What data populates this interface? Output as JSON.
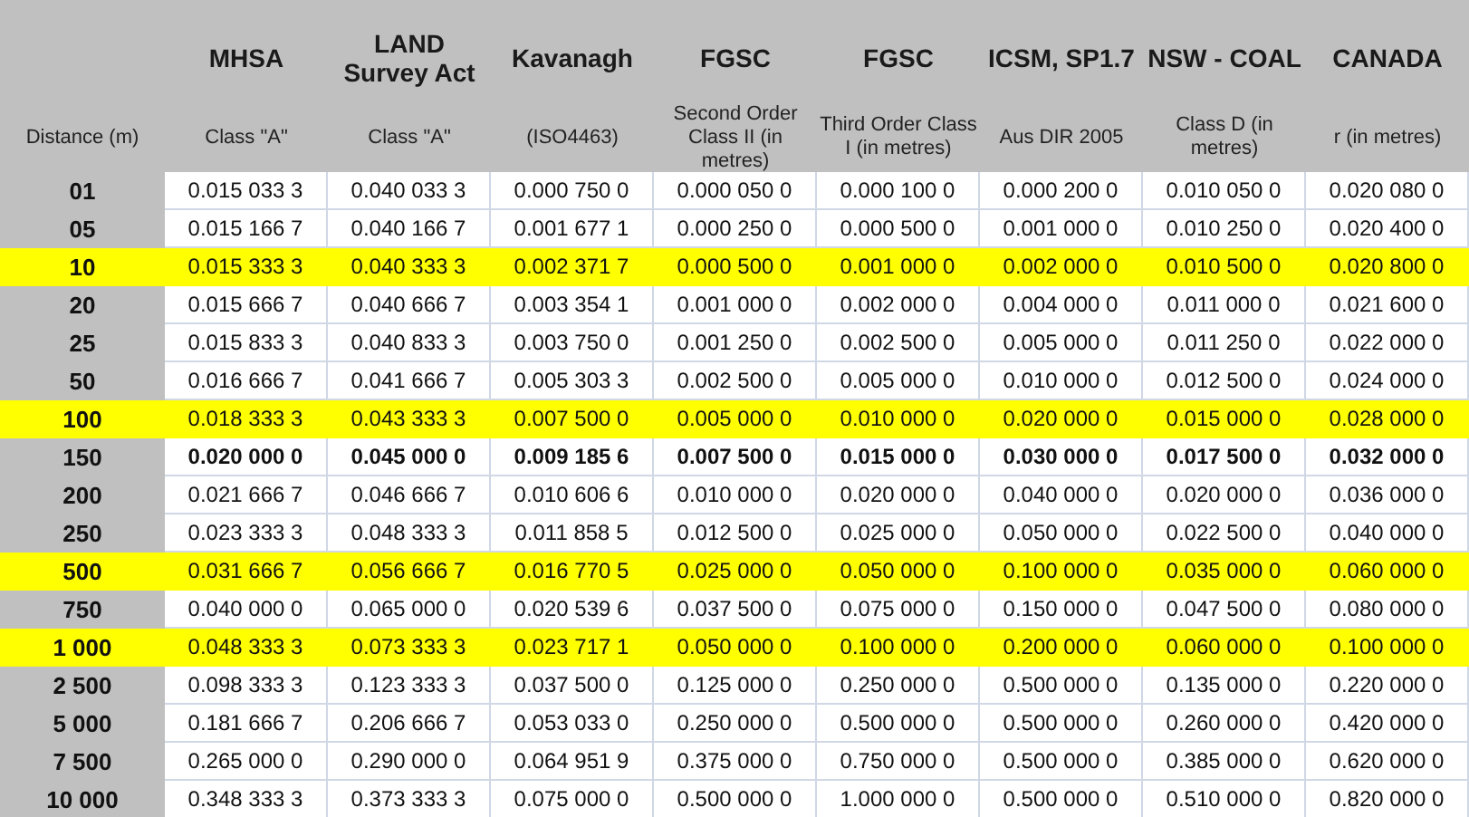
{
  "table": {
    "distance_header": "Distance (m)",
    "columns": [
      {
        "title": "MHSA",
        "subtitle": "Class \"A\""
      },
      {
        "title": "LAND Survey Act",
        "subtitle": "Class \"A\""
      },
      {
        "title": "Kavanagh",
        "subtitle": "(ISO4463)"
      },
      {
        "title": "FGSC",
        "subtitle": "Second Order Class II (in metres)"
      },
      {
        "title": "FGSC",
        "subtitle": "Third Order Class I (in metres)"
      },
      {
        "title": "ICSM, SP1.7",
        "subtitle": "Aus DIR 2005"
      },
      {
        "title": "NSW - COAL",
        "subtitle": "Class D (in metres)"
      },
      {
        "title": "CANADA",
        "subtitle": "r (in metres)"
      }
    ],
    "rows": [
      {
        "distance": "01",
        "highlighted": false,
        "bold": false,
        "values": [
          "0.015 033 3",
          "0.040 033 3",
          "0.000 750 0",
          "0.000 050 0",
          "0.000 100 0",
          "0.000 200 0",
          "0.010 050 0",
          "0.020 080 0"
        ]
      },
      {
        "distance": "05",
        "highlighted": false,
        "bold": false,
        "values": [
          "0.015 166 7",
          "0.040 166 7",
          "0.001 677 1",
          "0.000 250 0",
          "0.000 500 0",
          "0.001 000 0",
          "0.010 250 0",
          "0.020 400 0"
        ]
      },
      {
        "distance": "10",
        "highlighted": true,
        "bold": false,
        "values": [
          "0.015 333 3",
          "0.040 333 3",
          "0.002 371 7",
          "0.000 500 0",
          "0.001 000 0",
          "0.002 000 0",
          "0.010 500 0",
          "0.020 800 0"
        ]
      },
      {
        "distance": "20",
        "highlighted": false,
        "bold": false,
        "values": [
          "0.015 666 7",
          "0.040 666 7",
          "0.003 354 1",
          "0.001 000 0",
          "0.002 000 0",
          "0.004 000 0",
          "0.011 000 0",
          "0.021 600 0"
        ]
      },
      {
        "distance": "25",
        "highlighted": false,
        "bold": false,
        "values": [
          "0.015 833 3",
          "0.040 833 3",
          "0.003 750 0",
          "0.001 250 0",
          "0.002 500 0",
          "0.005 000 0",
          "0.011 250 0",
          "0.022 000 0"
        ]
      },
      {
        "distance": "50",
        "highlighted": false,
        "bold": false,
        "values": [
          "0.016 666 7",
          "0.041 666 7",
          "0.005 303 3",
          "0.002 500 0",
          "0.005 000 0",
          "0.010 000 0",
          "0.012 500 0",
          "0.024 000 0"
        ]
      },
      {
        "distance": "100",
        "highlighted": true,
        "bold": false,
        "values": [
          "0.018 333 3",
          "0.043 333 3",
          "0.007 500 0",
          "0.005 000 0",
          "0.010 000 0",
          "0.020 000 0",
          "0.015 000 0",
          "0.028 000 0"
        ]
      },
      {
        "distance": "150",
        "highlighted": false,
        "bold": true,
        "values": [
          "0.020 000 0",
          "0.045 000 0",
          "0.009 185 6",
          "0.007 500 0",
          "0.015 000 0",
          "0.030 000 0",
          "0.017 500 0",
          "0.032 000 0"
        ]
      },
      {
        "distance": "200",
        "highlighted": false,
        "bold": false,
        "values": [
          "0.021 666 7",
          "0.046 666 7",
          "0.010 606 6",
          "0.010 000 0",
          "0.020 000 0",
          "0.040 000 0",
          "0.020 000 0",
          "0.036 000 0"
        ]
      },
      {
        "distance": "250",
        "highlighted": false,
        "bold": false,
        "values": [
          "0.023 333 3",
          "0.048 333 3",
          "0.011 858 5",
          "0.012 500 0",
          "0.025 000 0",
          "0.050 000 0",
          "0.022 500 0",
          "0.040 000 0"
        ]
      },
      {
        "distance": "500",
        "highlighted": true,
        "bold": false,
        "values": [
          "0.031 666 7",
          "0.056 666 7",
          "0.016 770 5",
          "0.025 000 0",
          "0.050 000 0",
          "0.100 000 0",
          "0.035 000 0",
          "0.060 000 0"
        ]
      },
      {
        "distance": "750",
        "highlighted": false,
        "bold": false,
        "values": [
          "0.040 000 0",
          "0.065 000 0",
          "0.020 539 6",
          "0.037 500 0",
          "0.075 000 0",
          "0.150 000 0",
          "0.047 500 0",
          "0.080 000 0"
        ]
      },
      {
        "distance": "1 000",
        "highlighted": true,
        "bold": false,
        "values": [
          "0.048 333 3",
          "0.073 333 3",
          "0.023 717 1",
          "0.050 000 0",
          "0.100 000 0",
          "0.200 000 0",
          "0.060 000 0",
          "0.100 000 0"
        ]
      },
      {
        "distance": "2 500",
        "highlighted": false,
        "bold": false,
        "values": [
          "0.098 333 3",
          "0.123 333 3",
          "0.037 500 0",
          "0.125 000 0",
          "0.250 000 0",
          "0.500 000 0",
          "0.135 000 0",
          "0.220 000 0"
        ]
      },
      {
        "distance": "5 000",
        "highlighted": false,
        "bold": false,
        "values": [
          "0.181 666 7",
          "0.206 666 7",
          "0.053 033 0",
          "0.250 000 0",
          "0.500 000 0",
          "0.500 000 0",
          "0.260 000 0",
          "0.420 000 0"
        ]
      },
      {
        "distance": "7 500",
        "highlighted": false,
        "bold": false,
        "values": [
          "0.265 000 0",
          "0.290 000 0",
          "0.064 951 9",
          "0.375 000 0",
          "0.750 000 0",
          "0.500 000 0",
          "0.385 000 0",
          "0.620 000 0"
        ]
      },
      {
        "distance": "10 000",
        "highlighted": false,
        "bold": false,
        "values": [
          "0.348 333 3",
          "0.373 333 3",
          "0.075 000 0",
          "0.500 000 0",
          "1.000 000 0",
          "0.500 000 0",
          "0.510 000 0",
          "0.820 000 0"
        ]
      }
    ]
  }
}
